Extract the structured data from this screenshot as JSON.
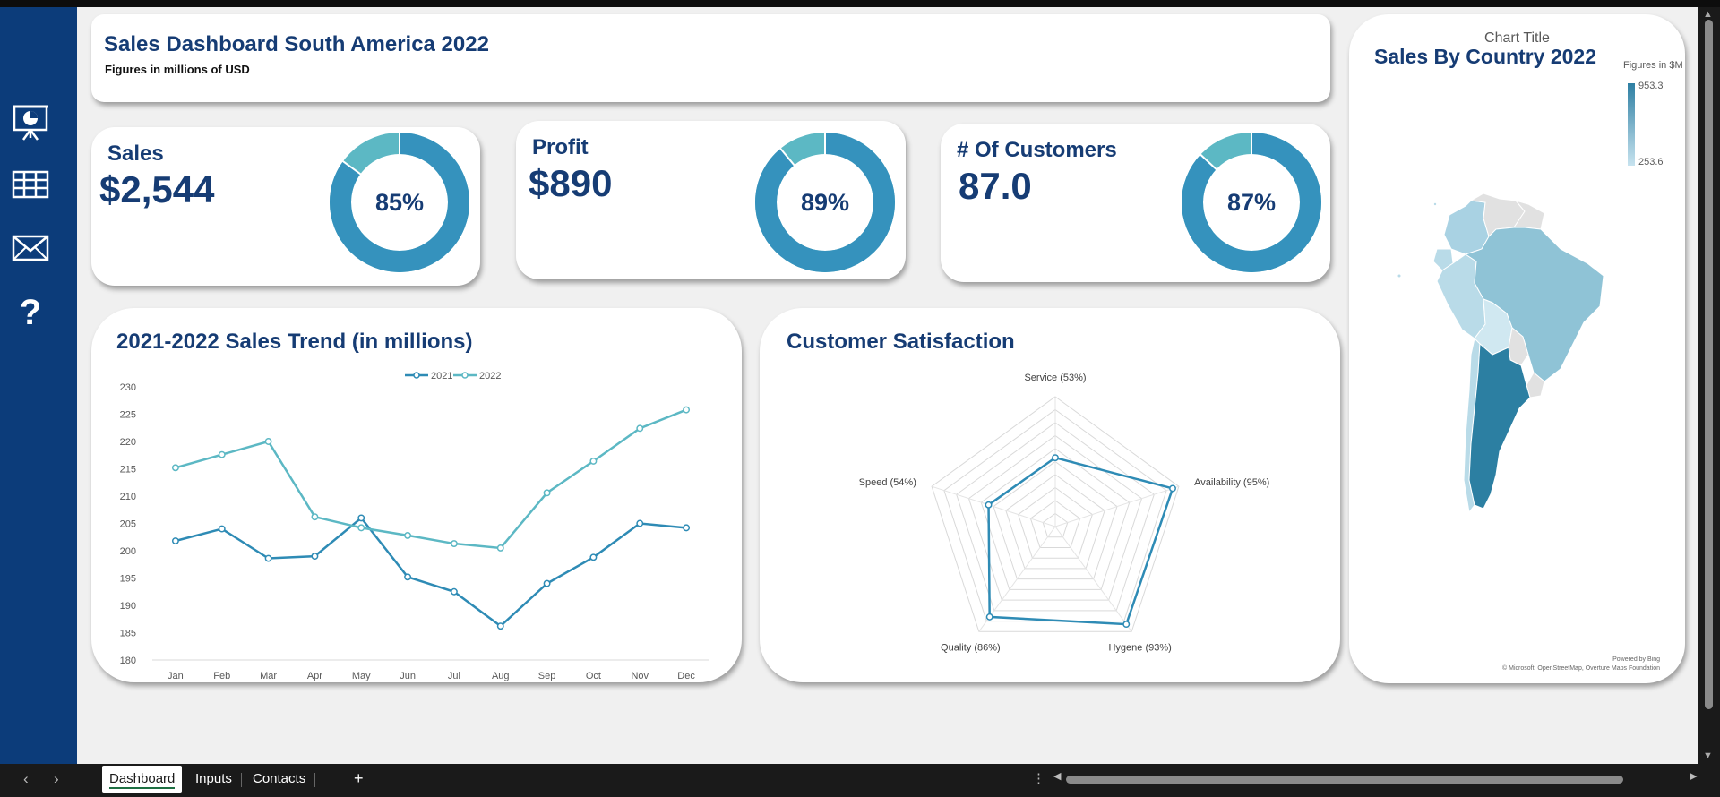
{
  "header": {
    "title": "Sales Dashboard South America 2022",
    "subtitle": "Figures in millions of USD"
  },
  "sidebar": {
    "items": [
      {
        "name": "presentation-icon"
      },
      {
        "name": "table-icon"
      },
      {
        "name": "mail-icon"
      },
      {
        "name": "help-icon"
      }
    ]
  },
  "kpis": [
    {
      "label": "Sales",
      "value": "$2,544",
      "percent_label": "85%",
      "percent": 0.85
    },
    {
      "label": "Profit",
      "value": "$890",
      "percent_label": "89%",
      "percent": 0.89
    },
    {
      "label": "# Of Customers",
      "value": "87.0",
      "percent_label": "87%",
      "percent": 0.87
    }
  ],
  "colors": {
    "navy": "#163c74",
    "series_2021": "#2e8bb5",
    "series_2022": "#5cb8c4",
    "donut_main": "#3592bd",
    "donut_rest": "#5cb8c4",
    "sidebar": "#0c3c7a"
  },
  "map": {
    "chart_title": "Chart Title",
    "title": "Sales By Country 2022",
    "legend_title": "Figures in $M",
    "legend_max": "953.3",
    "legend_min": "253.6",
    "credit_line1": "Powered by Bing",
    "credit_line2": "© Microsoft, OpenStreetMap, Overture Maps Foundation"
  },
  "chart_data": [
    {
      "type": "line",
      "title": "2021-2022 Sales Trend (in millions)",
      "categories": [
        "Jan",
        "Feb",
        "Mar",
        "Apr",
        "May",
        "Jun",
        "Jul",
        "Aug",
        "Sep",
        "Oct",
        "Nov",
        "Dec"
      ],
      "series": [
        {
          "name": "2021",
          "values": [
            201.8,
            204,
            198.6,
            199,
            206,
            195.2,
            192.5,
            186.2,
            194,
            198.8,
            205,
            204.2
          ]
        },
        {
          "name": "2022",
          "values": [
            215.2,
            217.6,
            220,
            206.2,
            204.2,
            202.8,
            201.3,
            200.5,
            210.6,
            216.4,
            222.4,
            225.8
          ]
        }
      ],
      "ylim": [
        180,
        230
      ],
      "yticks": [
        180,
        185,
        190,
        195,
        200,
        205,
        210,
        215,
        220,
        225,
        230
      ],
      "legend": "top",
      "grid": false
    },
    {
      "type": "radar",
      "title": "Customer Satisfaction",
      "axes": [
        {
          "label": "Service (53%)",
          "value": 53
        },
        {
          "label": "Availability (95%)",
          "value": 95
        },
        {
          "label": "Hygene (93%)",
          "value": 93
        },
        {
          "label": "Quality (86%)",
          "value": 86
        },
        {
          "label": "Speed (54%)",
          "value": 54
        }
      ],
      "max": 100,
      "rings": 10
    }
  ],
  "tabs": {
    "items": [
      "Dashboard",
      "Inputs",
      "Contacts"
    ],
    "active": "Dashboard",
    "add_label": "+"
  }
}
